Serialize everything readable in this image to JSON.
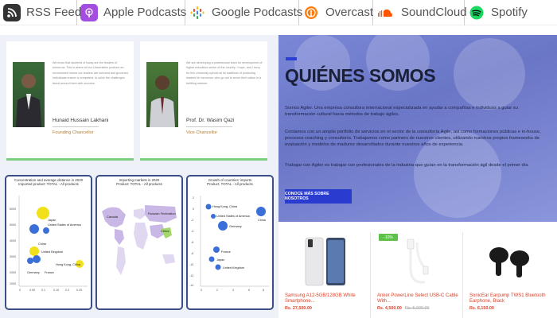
{
  "topbar": {
    "items": [
      {
        "label": "RSS Feed",
        "icon": "rss-icon"
      },
      {
        "label": "Apple Podcasts",
        "icon": "apple-podcasts-icon"
      },
      {
        "label": "Google Podcasts",
        "icon": "google-podcasts-icon"
      },
      {
        "label": "Overcast",
        "icon": "overcast-icon"
      },
      {
        "label": "SoundCloud",
        "icon": "soundcloud-icon"
      },
      {
        "label": "Spotify",
        "icon": "spotify-icon"
      }
    ]
  },
  "profiles": [
    {
      "bio": "We know that students of today are the leaders of tomorrow. This is where all our Universities produce an environment where our leaders are nurtured and groomed. Individuals ensure a competent, to solve the challenges faced around them with success.",
      "name": "Hunaid Hussain Lakhani",
      "role": "Founding Chancellor"
    },
    {
      "bio": "We are developing a professional team for development of higher education sector of the country. I hope, and I envy for this University uphold all its traditions of producing leaders for tomorrow, who go out to serve their nation in a befitting manner.",
      "name": "Prof. Dr. Wasim Qazi",
      "role": "Vice Chancellor"
    }
  ],
  "charts": [
    {
      "title": "Concentration and average distance in 2020",
      "subtitle": "Imported product: TOTAL - All products",
      "labels": [
        "Japan",
        "United States of America",
        "China",
        "United Kingdom",
        "Germany",
        "France",
        "Hong Kong, China"
      ],
      "y_ticks": [
        "6000",
        "5000",
        "4000",
        "3000",
        "2000",
        "1000"
      ],
      "x_ticks": [
        "0",
        "0.05",
        "0.1",
        "0.15",
        "0.2",
        "0.25"
      ]
    },
    {
      "title": "Importing markets in 2020",
      "subtitle": "Product: TOTAL - All products",
      "labels": [
        "Canada",
        "Russian Federation",
        "China"
      ]
    },
    {
      "title": "Growth of countries' imports",
      "subtitle": "Product: TOTAL - All products",
      "labels": [
        "Hong Kong, China",
        "United States of America",
        "Germany",
        "China",
        "France",
        "Japan",
        "United Kingdom"
      ],
      "y_ticks": [
        "2",
        "0",
        "-2",
        "-4",
        "-6",
        "-8",
        "-10",
        "-12",
        "-14"
      ],
      "x_ticks": [
        "0",
        "2",
        "4",
        "6",
        "8"
      ]
    }
  ],
  "hero": {
    "heading": "QUIÉNES SOMOS",
    "p1": "Somos Agiler. Una empresa consultora internacional especializada en ayudar a compañías e individuos a guiar su transformación cultural hacia métodos de trabajo ágiles.",
    "p2": "Contamos con un amplio portfolio de servicios en el sector de la consultoría Agile, así como formaciones públicas e in-house, procesos coaching y consultoría. Trabajamos como partners de nuestros clientes, utilizando nuestros propios frameworks de evaluación y modelos de madurez desarrollados durante nuestros años de experiencia.",
    "p3": "Trabajar con Agiler es trabajar con profesionales de la industria que guían en la transformación ágil desde el primer día",
    "button": "CONOCE MÁS SOBRE NOSOTROS"
  },
  "products": [
    {
      "name": "Samsung A12-5GB/128GB White Smartphone...",
      "price": "Rs. 27,500.00",
      "old_price": "",
      "badge": ""
    },
    {
      "name": "Anker PowerLine Select USB-C Cable With...",
      "price": "Rs. 4,500.00",
      "old_price": "Rs. 5,000.00",
      "badge": "-10%"
    },
    {
      "name": "SonicEar Earpump TWS1 Bluetooth Earphone, Black",
      "price": "Rs. 6,150.00",
      "old_price": "",
      "badge": ""
    }
  ],
  "colors": {
    "accent_green": "#7ccf7f",
    "chart_border": "#3b4f86",
    "hero_blue": "#2a3bd0",
    "price_red": "#d9432a"
  }
}
